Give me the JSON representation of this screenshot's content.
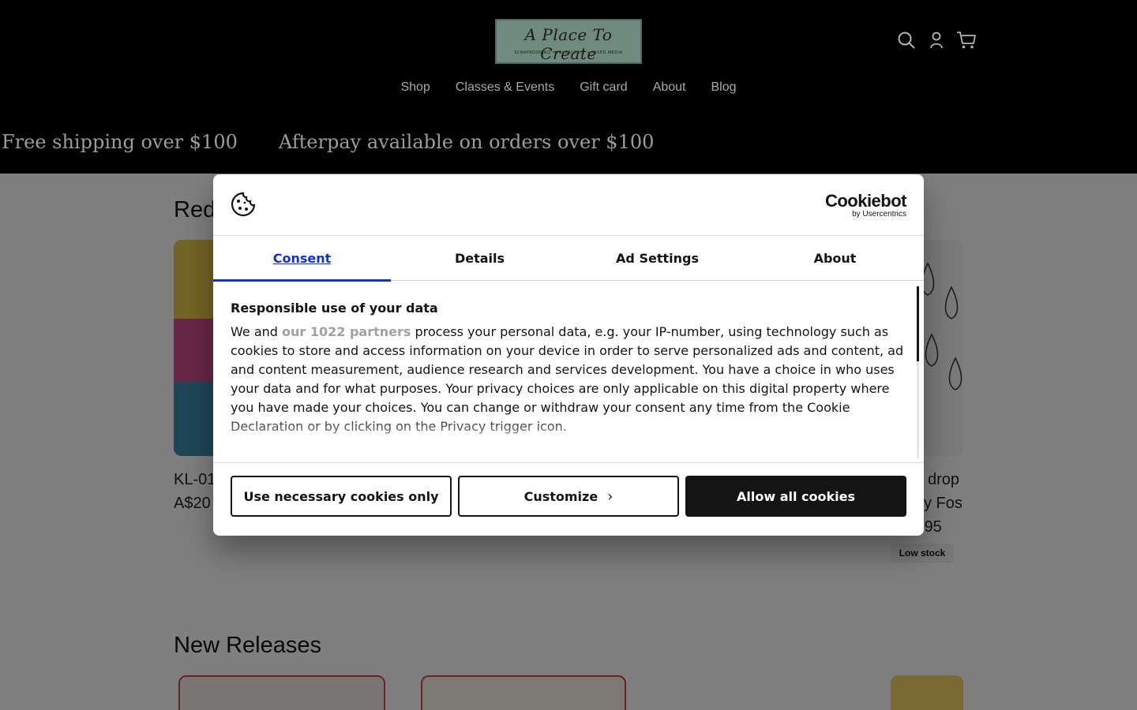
{
  "header": {
    "logo": {
      "script_text": "A Place To Create",
      "tagline": "SCRAPBOOKING • PAPERCRAFT • MIXED MEDIA"
    },
    "icons": [
      "search-icon",
      "account-icon",
      "cart-icon"
    ],
    "nav": [
      "Shop",
      "Classes & Events",
      "Gift card",
      "About",
      "Blog"
    ],
    "announcements": [
      "Free shipping over $100",
      "Afterpay available on orders over $100"
    ]
  },
  "page": {
    "section1_title": "Red",
    "card1_title": "KL-01",
    "card1_price": "A$20",
    "card4_title": "drop",
    "card4_subtitle": "ky Fos",
    "card4_price": ".95",
    "badge": "Low stock",
    "section2_title": "New Releases"
  },
  "dialog": {
    "brand": "Cookiebot",
    "brand_sub": "by Usercentrics",
    "tabs": [
      "Consent",
      "Details",
      "Ad Settings",
      "About"
    ],
    "heading": "Responsible use of your data",
    "body_prefix": "We and ",
    "partners_link": "our 1022 partners",
    "body_suffix": " process your personal data, e.g. your IP-number, using technology such as cookies to store and access information on your device in order to serve personalized ads and content, ad and content measurement, audience research and services development. You have a choice in who uses your data and for what purposes. Your privacy choices are only applicable on this digital property where you have made your choices. You can change or withdraw your consent any time from the Cookie Declaration or by clicking on the Privacy trigger icon.",
    "buttons": {
      "necessary": "Use necessary cookies only",
      "customize": "Customize",
      "allow": "Allow all cookies"
    }
  },
  "colors": {
    "accent": "#1032cf",
    "header_bg": "#000000",
    "button_dark": "#141414"
  }
}
